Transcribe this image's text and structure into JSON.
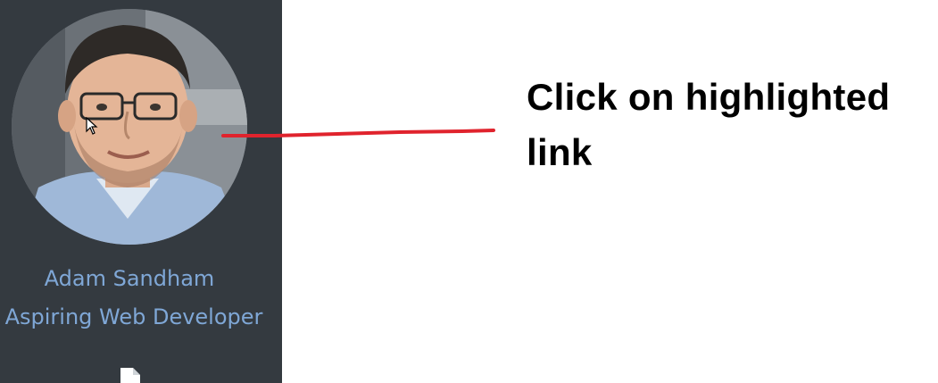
{
  "profile": {
    "name": "Adam Sandham",
    "role": "Aspiring Web Developer",
    "avatar_icon": "avatar-photo",
    "file_icon": "file-icon"
  },
  "annotation": {
    "text": "Click on highlighted link",
    "line_color": "#e0232d"
  },
  "colors": {
    "sidebar_bg": "#343a40",
    "link_color": "#7fa7d6",
    "page_bg": "#ffffff"
  }
}
